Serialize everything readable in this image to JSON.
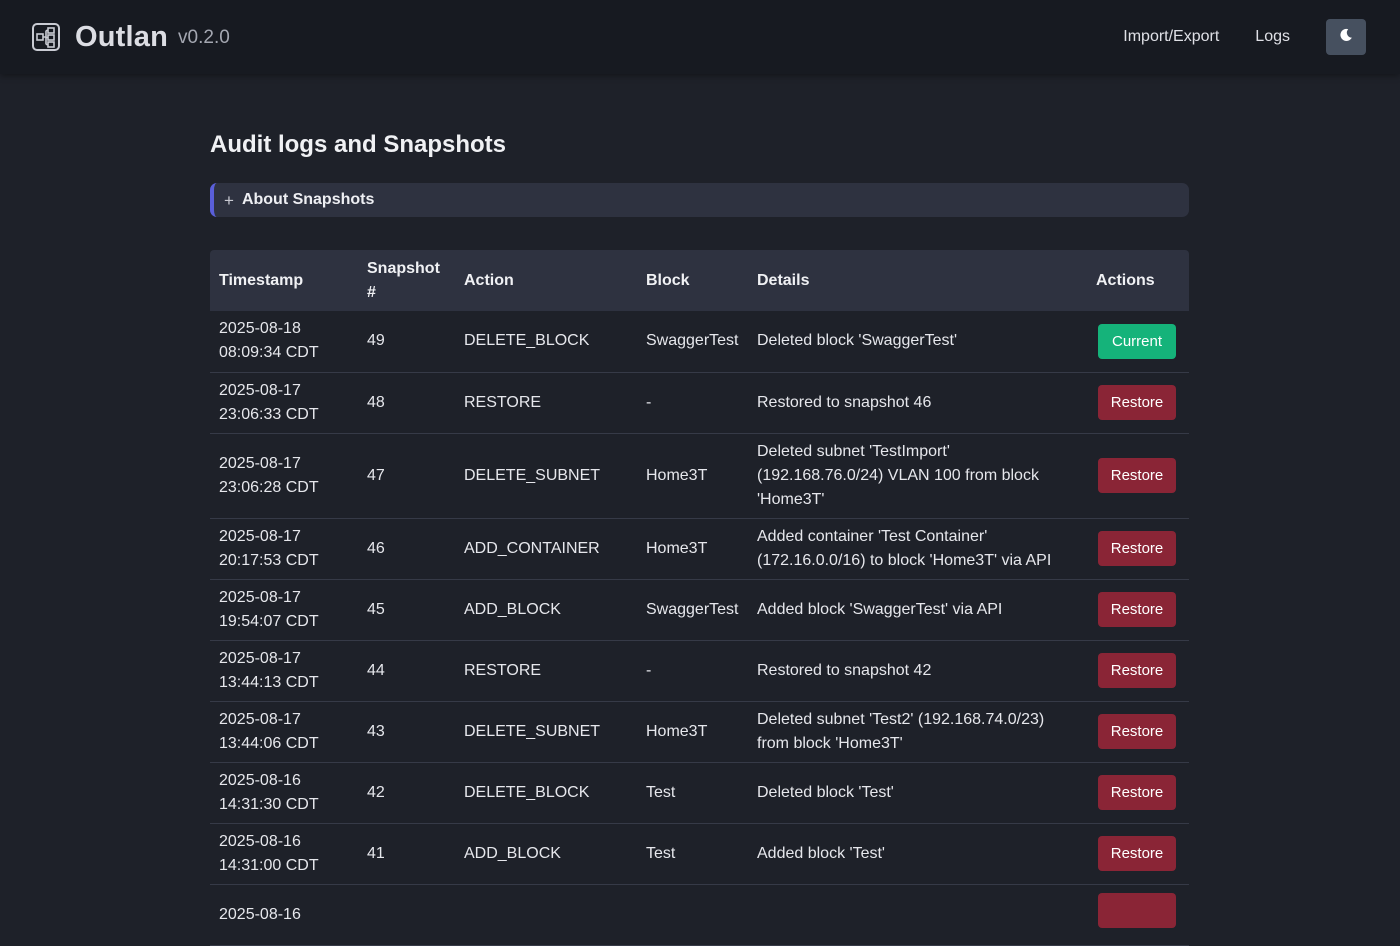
{
  "app": {
    "name": "Outlan",
    "version": "v0.2.0",
    "logo_icon": "network-diagram-icon"
  },
  "nav": {
    "import_export": "Import/Export",
    "logs": "Logs",
    "theme_icon": "moon-icon"
  },
  "page": {
    "title": "Audit logs and Snapshots",
    "about_toggle": "+",
    "about_label": "About Snapshots"
  },
  "table": {
    "headers": {
      "timestamp": "Timestamp",
      "snapshot": "Snapshot #",
      "action": "Action",
      "block": "Block",
      "details": "Details",
      "actions": "Actions"
    },
    "rows": [
      {
        "date": "2025-08-18",
        "time": "08:09:34 CDT",
        "snapshot": "49",
        "action": "DELETE_BLOCK",
        "block": "SwaggerTest",
        "details": "Deleted block 'SwaggerTest'",
        "button": "Current",
        "button_type": "current"
      },
      {
        "date": "2025-08-17",
        "time": "23:06:33 CDT",
        "snapshot": "48",
        "action": "RESTORE",
        "block": "-",
        "details": "Restored to snapshot 46",
        "button": "Restore",
        "button_type": "restore"
      },
      {
        "date": "2025-08-17",
        "time": "23:06:28 CDT",
        "snapshot": "47",
        "action": "DELETE_SUBNET",
        "block": "Home3T",
        "details": "Deleted subnet 'TestImport' (192.168.76.0/24) VLAN 100 from block 'Home3T'",
        "button": "Restore",
        "button_type": "restore"
      },
      {
        "date": "2025-08-17",
        "time": "20:17:53 CDT",
        "snapshot": "46",
        "action": "ADD_CONTAINER",
        "block": "Home3T",
        "details": "Added container 'Test Container' (172.16.0.0/16) to block 'Home3T' via API",
        "button": "Restore",
        "button_type": "restore"
      },
      {
        "date": "2025-08-17",
        "time": "19:54:07 CDT",
        "snapshot": "45",
        "action": "ADD_BLOCK",
        "block": "SwaggerTest",
        "details": "Added block 'SwaggerTest' via API",
        "button": "Restore",
        "button_type": "restore"
      },
      {
        "date": "2025-08-17",
        "time": "13:44:13 CDT",
        "snapshot": "44",
        "action": "RESTORE",
        "block": "-",
        "details": "Restored to snapshot 42",
        "button": "Restore",
        "button_type": "restore"
      },
      {
        "date": "2025-08-17",
        "time": "13:44:06 CDT",
        "snapshot": "43",
        "action": "DELETE_SUBNET",
        "block": "Home3T",
        "details": "Deleted subnet 'Test2' (192.168.74.0/23) from block 'Home3T'",
        "button": "Restore",
        "button_type": "restore"
      },
      {
        "date": "2025-08-16",
        "time": "14:31:30 CDT",
        "snapshot": "42",
        "action": "DELETE_BLOCK",
        "block": "Test",
        "details": "Deleted block 'Test'",
        "button": "Restore",
        "button_type": "restore"
      },
      {
        "date": "2025-08-16",
        "time": "14:31:00 CDT",
        "snapshot": "41",
        "action": "ADD_BLOCK",
        "block": "Test",
        "details": "Added block 'Test'",
        "button": "Restore",
        "button_type": "restore"
      },
      {
        "date": "2025-08-16",
        "time": "",
        "snapshot": "",
        "action": "",
        "block": "",
        "details": "",
        "button": "",
        "button_type": "restore"
      }
    ]
  },
  "colors": {
    "background": "#1e2129",
    "topbar": "#171a21",
    "header_row": "#2e3240",
    "accent": "#5a5fd9",
    "current_button": "#15b37a",
    "restore_button": "#8a2536"
  }
}
